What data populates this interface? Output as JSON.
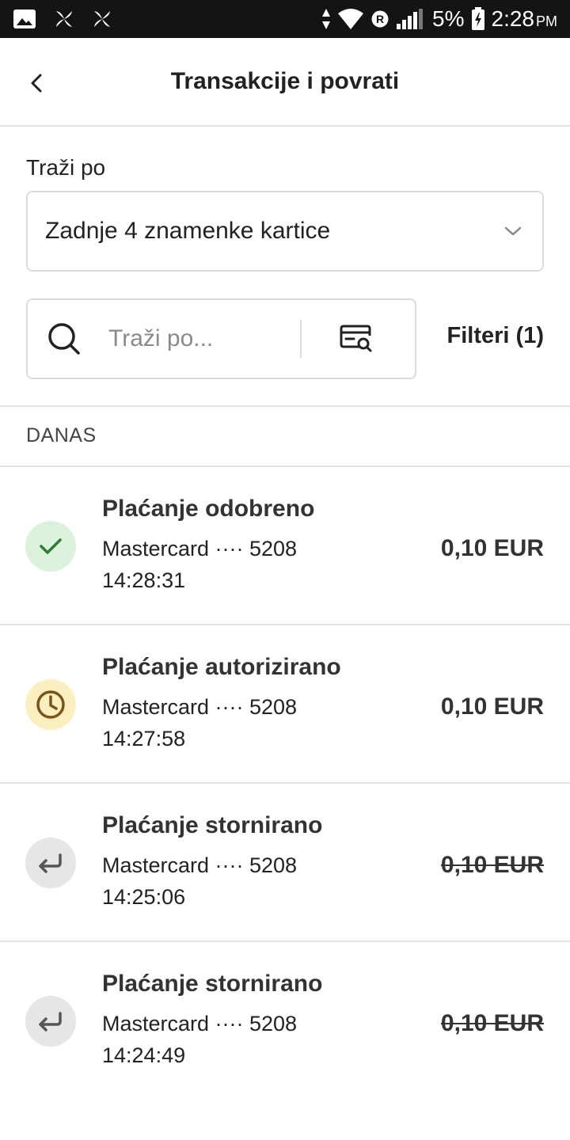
{
  "status_bar": {
    "battery": "5%",
    "time": "2:28",
    "ampm": "PM",
    "icons": [
      "image-icon",
      "pinwheel-icon",
      "pinwheel-icon",
      "data-arrows-icon",
      "wifi-icon",
      "roaming-r-icon",
      "signal-icon",
      "battery-charging-icon"
    ]
  },
  "header": {
    "title": "Transakcije i povrati",
    "back_icon": "chevron-left-icon"
  },
  "search": {
    "label": "Traži po",
    "dropdown_value": "Zadnje 4 znamenke kartice",
    "placeholder": "Traži po...",
    "filters_label": "Filteri (1)"
  },
  "section": {
    "title": "DANAS"
  },
  "colors": {
    "approved_bg": "#dcf2dc",
    "approved_fg": "#2e7d32",
    "authorized_bg": "#fbefc2",
    "authorized_fg": "#7a5418",
    "reversed_bg": "#e6e6e6",
    "reversed_fg": "#555555"
  },
  "transactions": [
    {
      "title": "Plaćanje odobreno",
      "card": "Mastercard ···· 5208",
      "time": "14:28:31",
      "amount": "0,10 EUR",
      "status": "approved",
      "icon": "check-icon"
    },
    {
      "title": "Plaćanje autorizirano",
      "card": "Mastercard ···· 5208",
      "time": "14:27:58",
      "amount": "0,10 EUR",
      "status": "authorized",
      "icon": "clock-icon"
    },
    {
      "title": "Plaćanje stornirano",
      "card": "Mastercard ···· 5208",
      "time": "14:25:06",
      "amount": "0,10 EUR",
      "status": "reversed",
      "icon": "return-arrow-icon"
    },
    {
      "title": "Plaćanje stornirano",
      "card": "Mastercard ···· 5208",
      "time": "14:24:49",
      "amount": "0,10 EUR",
      "status": "reversed",
      "icon": "return-arrow-icon"
    }
  ]
}
